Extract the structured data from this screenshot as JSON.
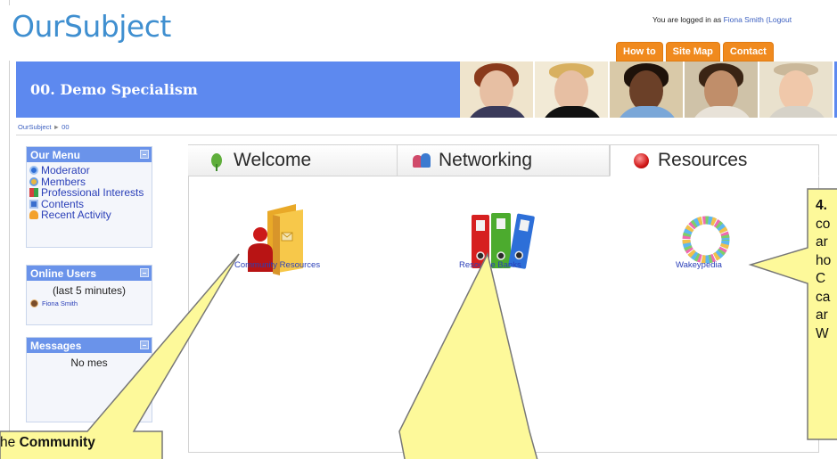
{
  "header": {
    "logo": "OurSubject",
    "login_prefix": "You are logged in as ",
    "login_user": "Fiona Smith",
    "login_logout": " (Logout",
    "top_tabs": [
      "How to",
      "Site Map",
      "Contact"
    ]
  },
  "banner": {
    "title": "00. Demo Specialism"
  },
  "breadcrumb": {
    "home": "OurSubject",
    "separator": "►",
    "current": "00"
  },
  "sidebar": {
    "menu": {
      "title": "Our Menu",
      "items": [
        {
          "label": "Moderator",
          "icon": "moderator-icon"
        },
        {
          "label": "Members",
          "icon": "members-icon"
        },
        {
          "label": "Professional Interests",
          "icon": "interests-icon"
        },
        {
          "label": "Contents",
          "icon": "contents-icon"
        },
        {
          "label": "Recent Activity",
          "icon": "activity-icon"
        }
      ]
    },
    "online": {
      "title": "Online Users",
      "subtitle": "(last 5 minutes)",
      "user": "Fiona Smith"
    },
    "messages": {
      "title": "Messages",
      "text": "No mes"
    }
  },
  "content_tabs": [
    {
      "label": "Welcome",
      "icon": "leaf-icon"
    },
    {
      "label": "Networking",
      "icon": "people-icon"
    },
    {
      "label": "Resources",
      "icon": "red-ball-icon"
    }
  ],
  "resources": [
    {
      "label": "Community Resources",
      "icon": "folder-person-icon"
    },
    {
      "label": "Resource Banks",
      "icon": "binders-icon"
    },
    {
      "label": "Wakeypedia",
      "icon": "people-ring-icon"
    }
  ],
  "callouts": {
    "right": {
      "line1": "4.",
      "lines": [
        "co",
        "ar",
        "ho",
        "C",
        "ca",
        "ar",
        "W"
      ]
    },
    "left": {
      "prefix": "he ",
      "bold": "Community"
    }
  },
  "colors": {
    "brand_blue": "#3f8fd0",
    "banner_blue": "#5d89ef",
    "orange_tab": "#f08a1e",
    "callout_yellow": "#fdf99a"
  }
}
